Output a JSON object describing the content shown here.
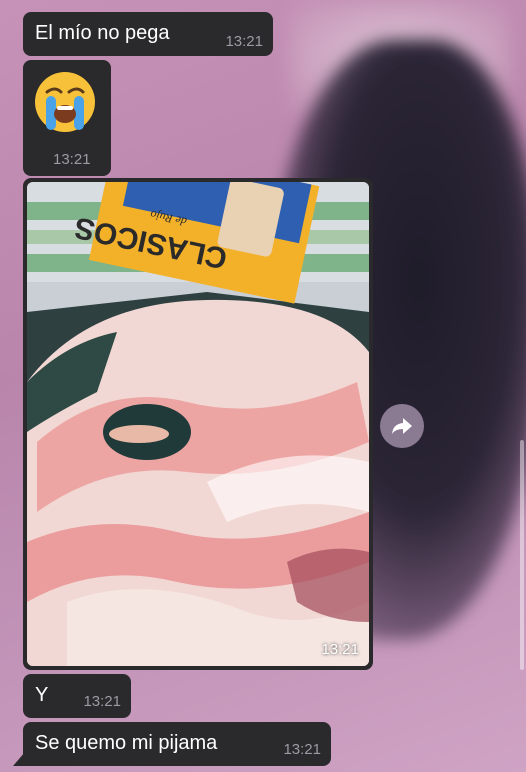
{
  "messages": [
    {
      "text": "El mío no pega",
      "time": "13:21"
    },
    {
      "emoji": "loudly-crying-face",
      "time": "13:21"
    },
    {
      "photo": "pajama-with-burn-hole",
      "photo_label": "CLASICOS",
      "photo_label_sub": "de Rujo",
      "time": "13:21"
    },
    {
      "text": "Y",
      "time": "13:21"
    },
    {
      "text": "Se quemo mi pijama",
      "time": "13:21"
    }
  ],
  "colors": {
    "bubble": "#2a2a2c",
    "wallpaper": "#c08fb4",
    "time_text": "#9c9aa2",
    "forward_button": "#8a7a92"
  },
  "icons": {
    "forward": "share-arrow-icon"
  }
}
